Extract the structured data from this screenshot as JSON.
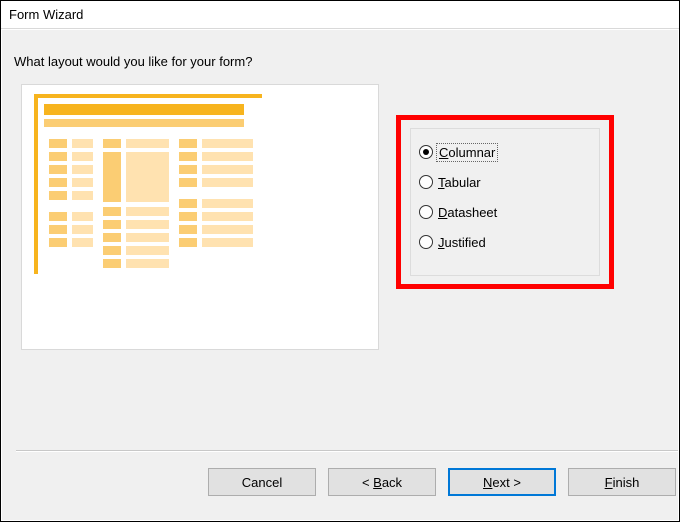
{
  "title": "Form Wizard",
  "question": "What layout would you like for your form?",
  "options": {
    "columnar": "Columnar",
    "tabular": "Tabular",
    "datasheet": "Datasheet",
    "justified": "Justified",
    "selected": "columnar",
    "focused": "columnar"
  },
  "buttons": {
    "cancel": "Cancel",
    "back": "< Back",
    "next": "Next >",
    "finish": "Finish"
  }
}
